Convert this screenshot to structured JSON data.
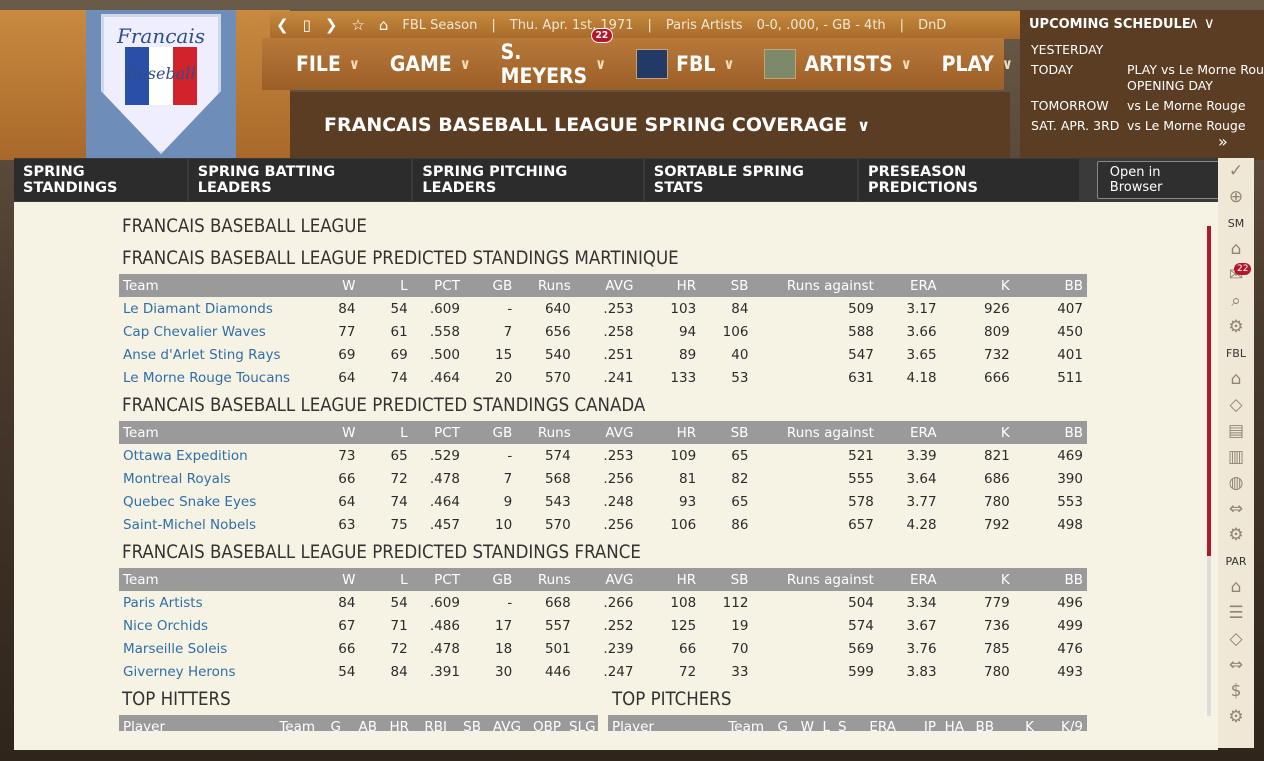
{
  "topbar": {
    "season": "FBL Season",
    "date": "Thu. Apr. 1st, 1971",
    "team": "Paris Artists",
    "record": "0-0, .000, - GB - 4th",
    "extra": "DnD"
  },
  "menu": {
    "items": [
      {
        "label": "FILE"
      },
      {
        "label": "GAME"
      },
      {
        "label": "S. MEYERS",
        "badge": "22"
      },
      {
        "label": "FBL"
      },
      {
        "label": "ARTISTS"
      },
      {
        "label": "PLAY"
      }
    ]
  },
  "logo": {
    "line1": "Francais",
    "line2": "Baseball"
  },
  "page_title": "FRANCAIS BASEBALL LEAGUE SPRING COVERAGE",
  "schedule": {
    "title": "UPCOMING SCHEDULE",
    "rows": [
      {
        "day": "YESTERDAY",
        "text": ""
      },
      {
        "day": "TODAY",
        "text": "PLAY vs Le Morne Rouge",
        "text2": "OPENING DAY"
      },
      {
        "day": "TOMORROW",
        "text": "vs Le Morne Rouge"
      },
      {
        "day": "SAT. APR. 3RD",
        "text": "vs Le Morne Rouge"
      }
    ],
    "more": "»"
  },
  "tabs": [
    "SPRING STANDINGS",
    "SPRING BATTING LEADERS",
    "SPRING PITCHING LEADERS",
    "SORTABLE SPRING STATS",
    "PRESEASON PREDICTIONS"
  ],
  "open_browser": "Open in Browser",
  "sidebar": {
    "labels": {
      "sm": "SM",
      "fbl": "FBL",
      "par": "PAR"
    },
    "mail_badge": "22"
  },
  "league_title": "FRANCAIS BASEBALL LEAGUE",
  "columns": [
    "Team",
    "W",
    "L",
    "PCT",
    "GB",
    "Runs",
    "AVG",
    "HR",
    "SB",
    "Runs against",
    "ERA",
    "K",
    "BB"
  ],
  "divisions": [
    {
      "title": "FRANCAIS BASEBALL LEAGUE PREDICTED STANDINGS MARTINIQUE",
      "rows": [
        [
          "Le Diamant Diamonds",
          "84",
          "54",
          ".609",
          "-",
          "640",
          ".253",
          "103",
          "84",
          "509",
          "3.17",
          "926",
          "407"
        ],
        [
          "Cap Chevalier Waves",
          "77",
          "61",
          ".558",
          "7",
          "656",
          ".258",
          "94",
          "106",
          "588",
          "3.66",
          "809",
          "450"
        ],
        [
          "Anse d'Arlet Sting Rays",
          "69",
          "69",
          ".500",
          "15",
          "540",
          ".251",
          "89",
          "40",
          "547",
          "3.65",
          "732",
          "401"
        ],
        [
          "Le Morne Rouge Toucans",
          "64",
          "74",
          ".464",
          "20",
          "570",
          ".241",
          "133",
          "53",
          "631",
          "4.18",
          "666",
          "511"
        ]
      ]
    },
    {
      "title": "FRANCAIS BASEBALL LEAGUE PREDICTED STANDINGS CANADA",
      "rows": [
        [
          "Ottawa Expedition",
          "73",
          "65",
          ".529",
          "-",
          "574",
          ".253",
          "109",
          "65",
          "521",
          "3.39",
          "821",
          "469"
        ],
        [
          "Montreal Royals",
          "66",
          "72",
          ".478",
          "7",
          "568",
          ".256",
          "81",
          "82",
          "555",
          "3.64",
          "686",
          "390"
        ],
        [
          "Quebec Snake Eyes",
          "64",
          "74",
          ".464",
          "9",
          "543",
          ".248",
          "93",
          "65",
          "578",
          "3.77",
          "780",
          "553"
        ],
        [
          "Saint-Michel Nobels",
          "63",
          "75",
          ".457",
          "10",
          "570",
          ".256",
          "106",
          "86",
          "657",
          "4.28",
          "792",
          "498"
        ]
      ]
    },
    {
      "title": "FRANCAIS BASEBALL LEAGUE PREDICTED STANDINGS FRANCE",
      "rows": [
        [
          "Paris Artists",
          "84",
          "54",
          ".609",
          "-",
          "668",
          ".266",
          "108",
          "112",
          "504",
          "3.34",
          "779",
          "496"
        ],
        [
          "Nice Orchids",
          "67",
          "71",
          ".486",
          "17",
          "557",
          ".252",
          "125",
          "19",
          "574",
          "3.67",
          "736",
          "499"
        ],
        [
          "Marseille Soleis",
          "66",
          "72",
          ".478",
          "18",
          "501",
          ".239",
          "66",
          "70",
          "569",
          "3.76",
          "785",
          "476"
        ],
        [
          "Giverney Herons",
          "54",
          "84",
          ".391",
          "30",
          "446",
          ".247",
          "72",
          "33",
          "599",
          "3.83",
          "780",
          "493"
        ]
      ]
    }
  ],
  "top_hitters": {
    "title": "TOP HITTERS",
    "columns": [
      "Player",
      "Team",
      "G",
      "AB",
      "HR",
      "RBI",
      "SB",
      "AVG",
      "OBP",
      "SLG"
    ]
  },
  "top_pitchers": {
    "title": "TOP PITCHERS",
    "columns": [
      "Player",
      "Team",
      "G",
      "W",
      "L",
      "S",
      "ERA",
      "IP",
      "HA",
      "BB",
      "K",
      "K/9"
    ]
  }
}
